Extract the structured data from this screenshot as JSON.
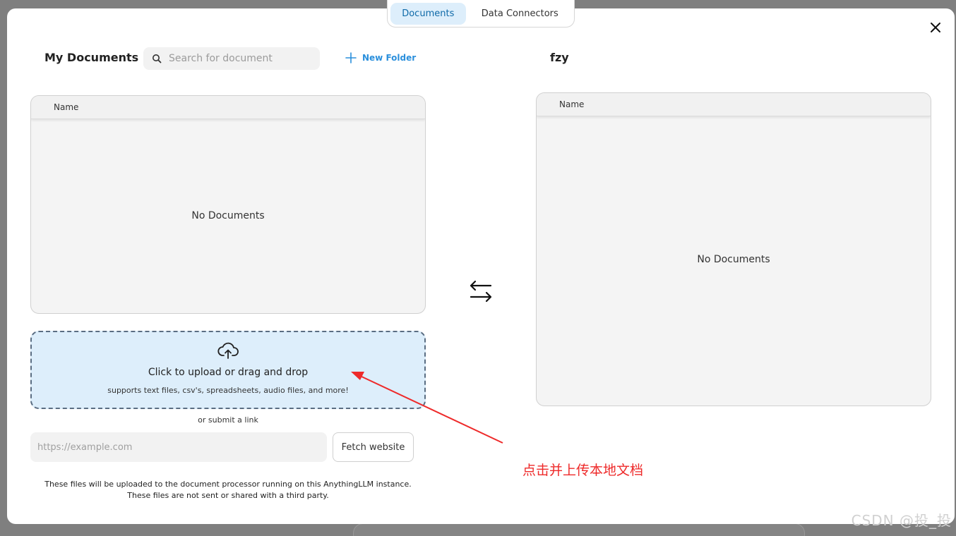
{
  "tabs": [
    {
      "label": "Documents",
      "active": true
    },
    {
      "label": "Data Connectors",
      "active": false
    }
  ],
  "left": {
    "title": "My Documents",
    "search_placeholder": "Search for document",
    "new_folder_label": "New Folder",
    "table_header": "Name",
    "empty_text": "No Documents"
  },
  "upload": {
    "main_text": "Click to upload or drag and drop",
    "sub_text": "supports text files, csv's, spreadsheets, audio files, and more!",
    "or_link": "or submit a link",
    "url_placeholder": "https://example.com",
    "fetch_label": "Fetch website",
    "notice_line1": "These files will be uploaded to the document processor running on this AnythingLLM instance.",
    "notice_line2": "These files are not sent or shared with a third party."
  },
  "right": {
    "title": "fzy",
    "table_header": "Name",
    "empty_text": "No Documents"
  },
  "annotation": {
    "text": "点击并上传本地文档",
    "color": "#ee2a2a"
  },
  "watermark": "CSDN @投_投",
  "colors": {
    "accent": "#2a8fdc",
    "active_tab_bg": "#ddeefb",
    "upload_bg": "#ddeefb"
  },
  "icons": [
    "search-icon",
    "plus-icon",
    "close-icon",
    "upload-cloud-icon",
    "swap-arrows-icon"
  ]
}
